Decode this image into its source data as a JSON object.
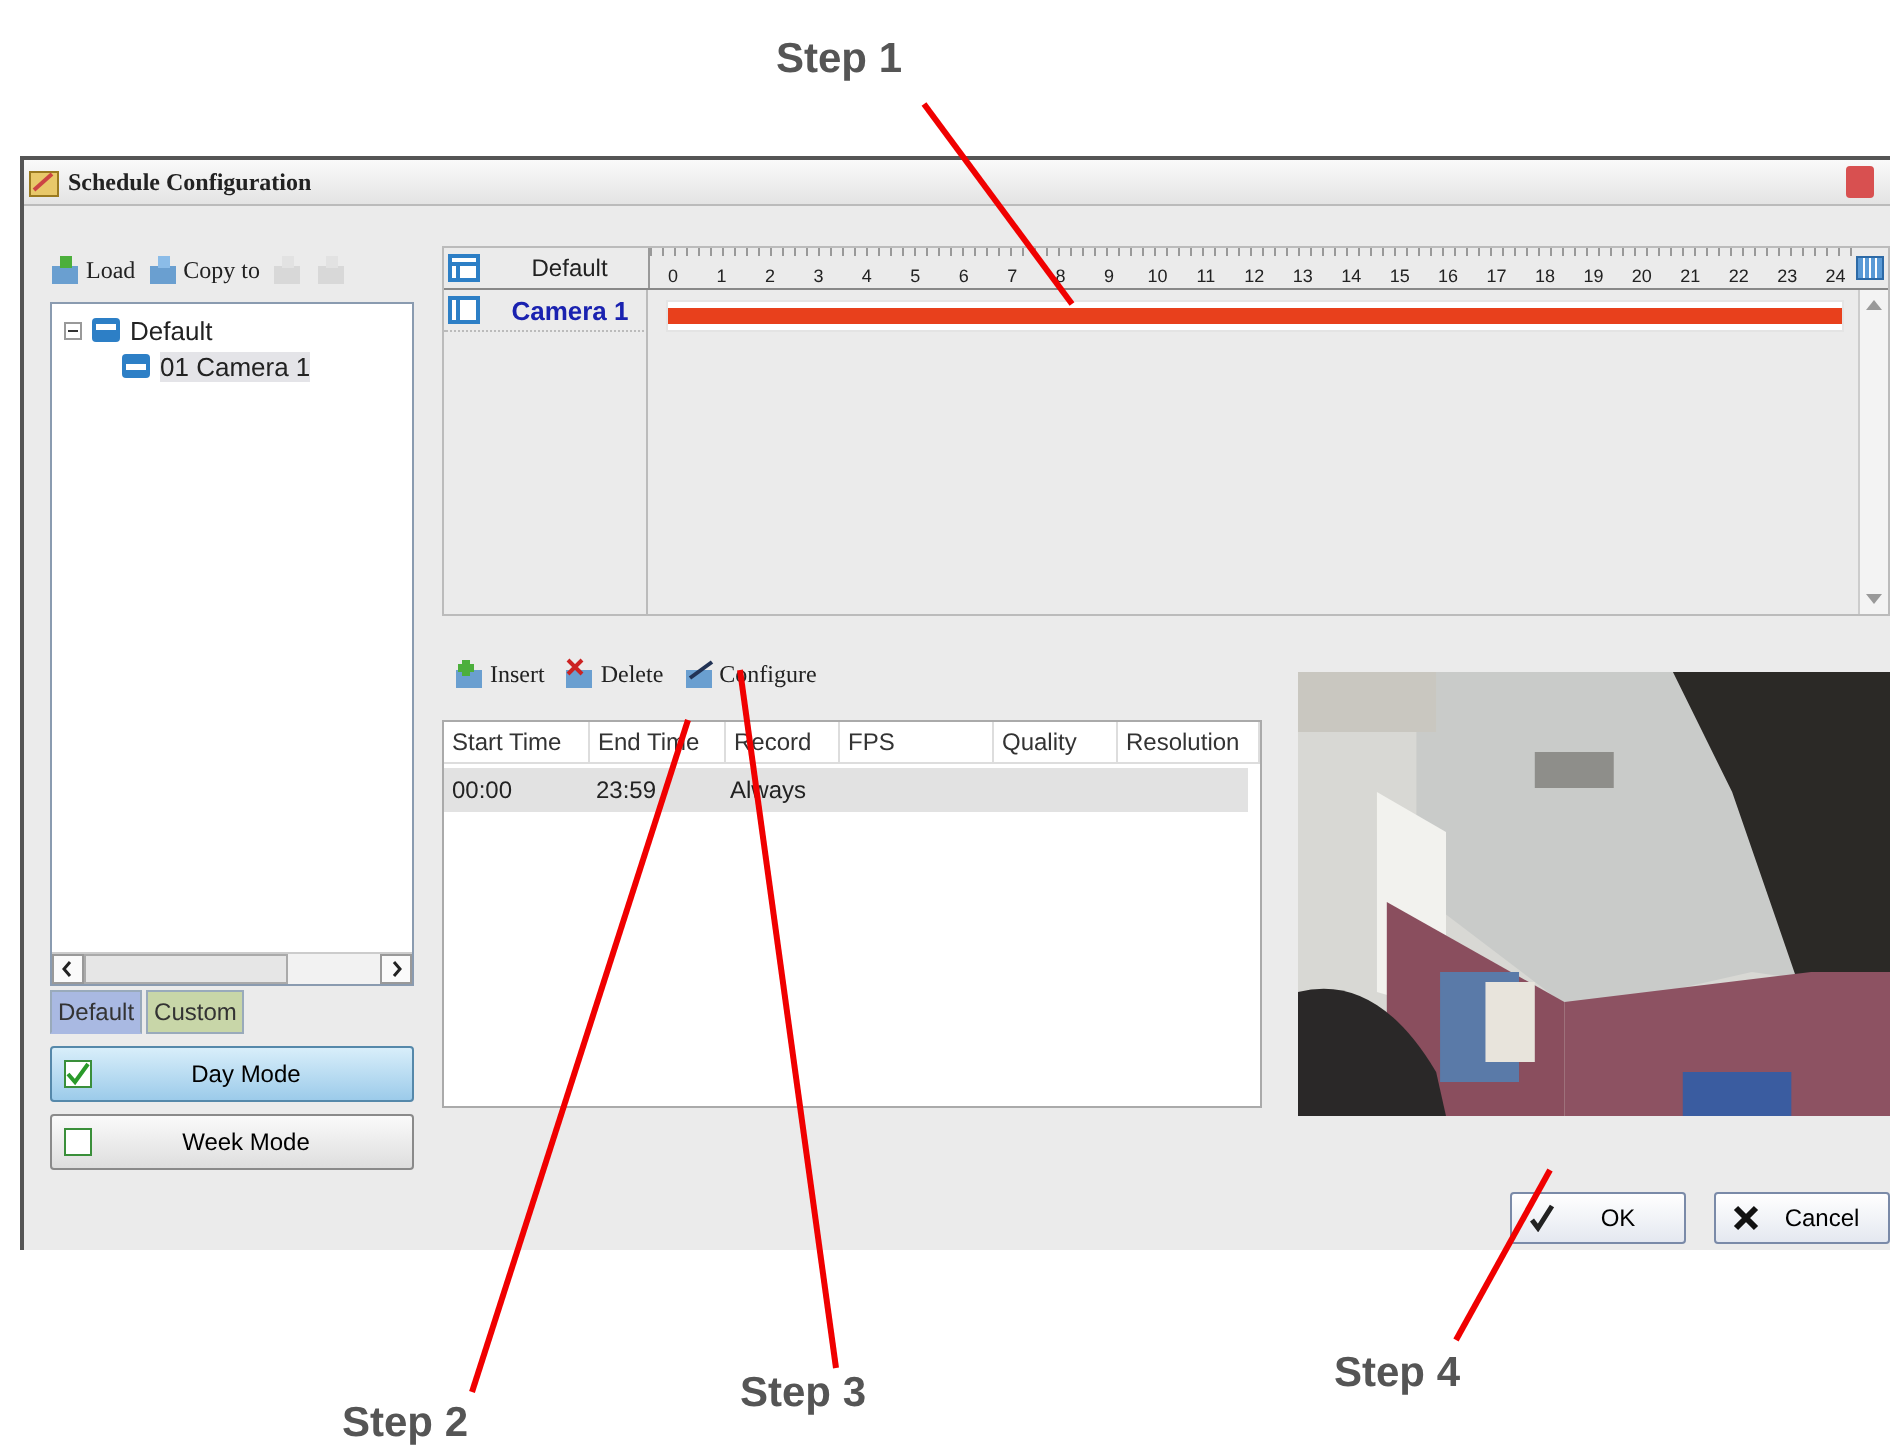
{
  "window": {
    "title": "Schedule Configuration"
  },
  "left_toolbar": [
    {
      "label": "Load",
      "disabled": false
    },
    {
      "label": "Copy to",
      "disabled": false
    },
    {
      "disabled": true
    },
    {
      "disabled": true
    }
  ],
  "tree": [
    {
      "label": "Default",
      "expanded": true,
      "children": [
        {
          "label": "01 Camera 1",
          "selected": true
        }
      ]
    }
  ],
  "left_tabs": [
    {
      "label": "Default",
      "selected": true
    },
    {
      "label": "Custom",
      "selected": false
    }
  ],
  "modes": [
    {
      "label": "Day Mode",
      "checked": true
    },
    {
      "label": "Week Mode",
      "checked": false
    }
  ],
  "timeline": {
    "group": "Default",
    "hours": [
      "0",
      "1",
      "2",
      "3",
      "4",
      "5",
      "6",
      "7",
      "8",
      "9",
      "10",
      "11",
      "12",
      "13",
      "14",
      "15",
      "16",
      "17",
      "18",
      "19",
      "20",
      "21",
      "22",
      "23",
      "24"
    ],
    "rows": [
      {
        "camera": "Camera 1",
        "level": 1
      }
    ]
  },
  "schedule_toolbar": [
    {
      "label": "Insert"
    },
    {
      "label": "Delete"
    },
    {
      "label": "Configure"
    }
  ],
  "table": {
    "columns": [
      "Start Time",
      "End Time",
      "Record",
      "FPS",
      "Quality",
      "Resolution"
    ],
    "rows": [
      {
        "start_time": "00:00",
        "end_time": "23:59",
        "record": "Always",
        "selected": true
      }
    ]
  },
  "buttons": [
    {
      "label": "OK",
      "kind": "ok"
    },
    {
      "label": "Cancel",
      "kind": "cancel"
    }
  ],
  "annotations": [
    {
      "label": "Step 1"
    },
    {
      "label": "Step 2"
    },
    {
      "label": "Step 3"
    },
    {
      "label": "Step 4"
    }
  ]
}
